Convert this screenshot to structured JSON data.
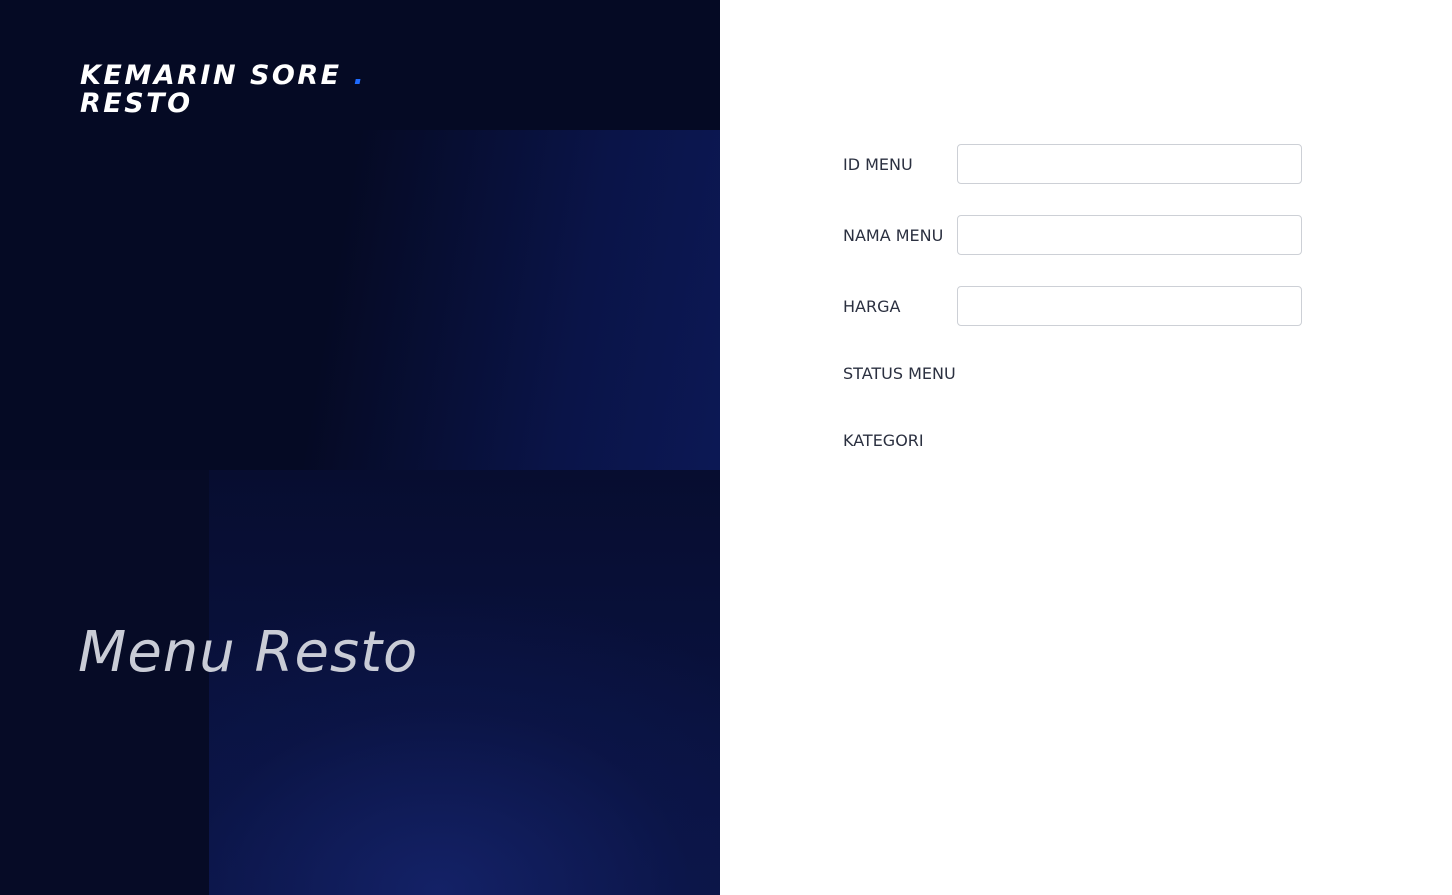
{
  "brand": {
    "line1": "KEMARIN SORE",
    "dot": ".",
    "line2": "RESTO",
    "accent_color": "#1e6bff"
  },
  "hero": {
    "title": "Menu Resto"
  },
  "form": {
    "id_menu": {
      "label": "ID MENU",
      "value": "",
      "placeholder": ""
    },
    "nama_menu": {
      "label": "NAMA MENU",
      "value": "",
      "placeholder": ""
    },
    "harga": {
      "label": "HARGA",
      "value": "",
      "placeholder": ""
    },
    "status_menu": {
      "label": "STATUS MENU"
    },
    "kategori": {
      "label": "KATEGORI"
    }
  },
  "colors": {
    "panel_bg": "#050a24",
    "label_text": "#2b3040",
    "input_border": "#cdd0d6"
  }
}
